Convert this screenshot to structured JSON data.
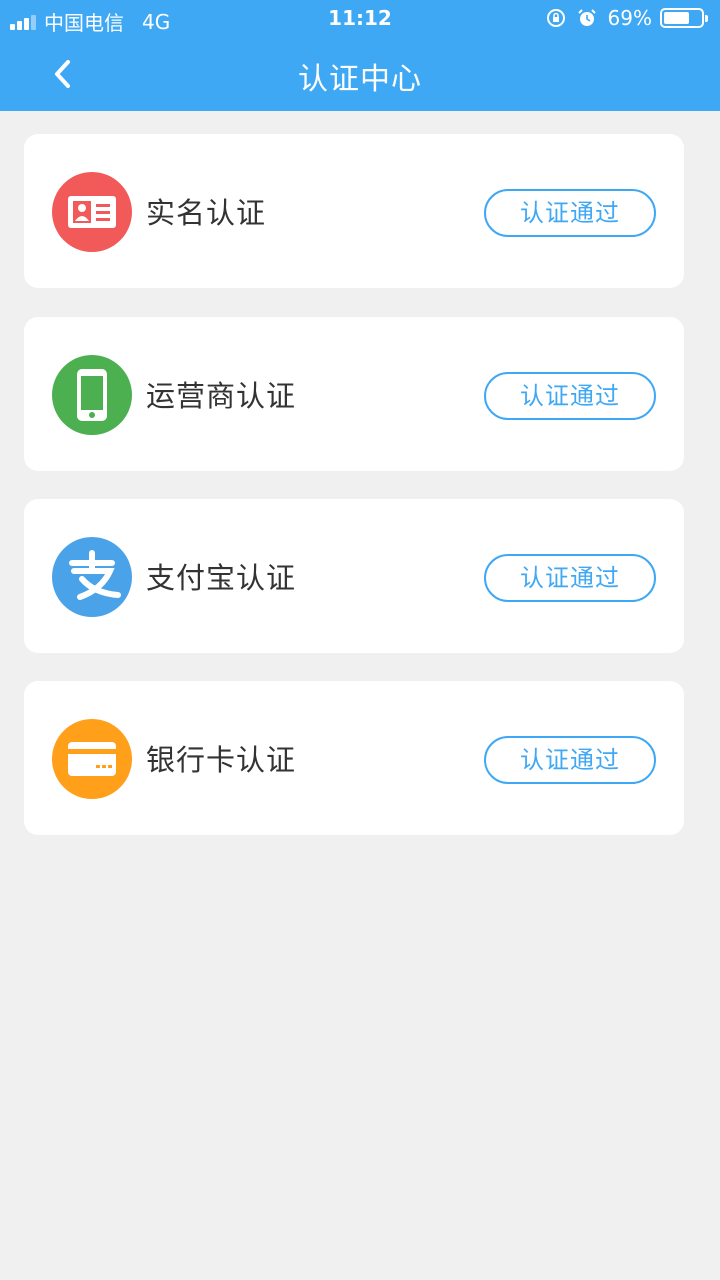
{
  "status_bar": {
    "carrier": "中国电信",
    "network": "4G",
    "time": "11:12",
    "battery": "69%",
    "battery_level": 0.69
  },
  "header": {
    "title": "认证中心",
    "back_icon": "chevron-left-icon"
  },
  "colors": {
    "primary": "#3fa8f5",
    "background": "#f0f0f0",
    "id_red": "#f25a5a",
    "phone_green": "#4caf50",
    "alipay_blue": "#4aa3e8",
    "bank_orange": "#ff9f1a"
  },
  "items": [
    {
      "label": "实名认证",
      "status": "认证通过",
      "icon": "id-card-icon"
    },
    {
      "label": "运营商认证",
      "status": "认证通过",
      "icon": "mobile-phone-icon"
    },
    {
      "label": "支付宝认证",
      "status": "认证通过",
      "icon": "alipay-icon"
    },
    {
      "label": "银行卡认证",
      "status": "认证通过",
      "icon": "bank-card-icon"
    }
  ]
}
